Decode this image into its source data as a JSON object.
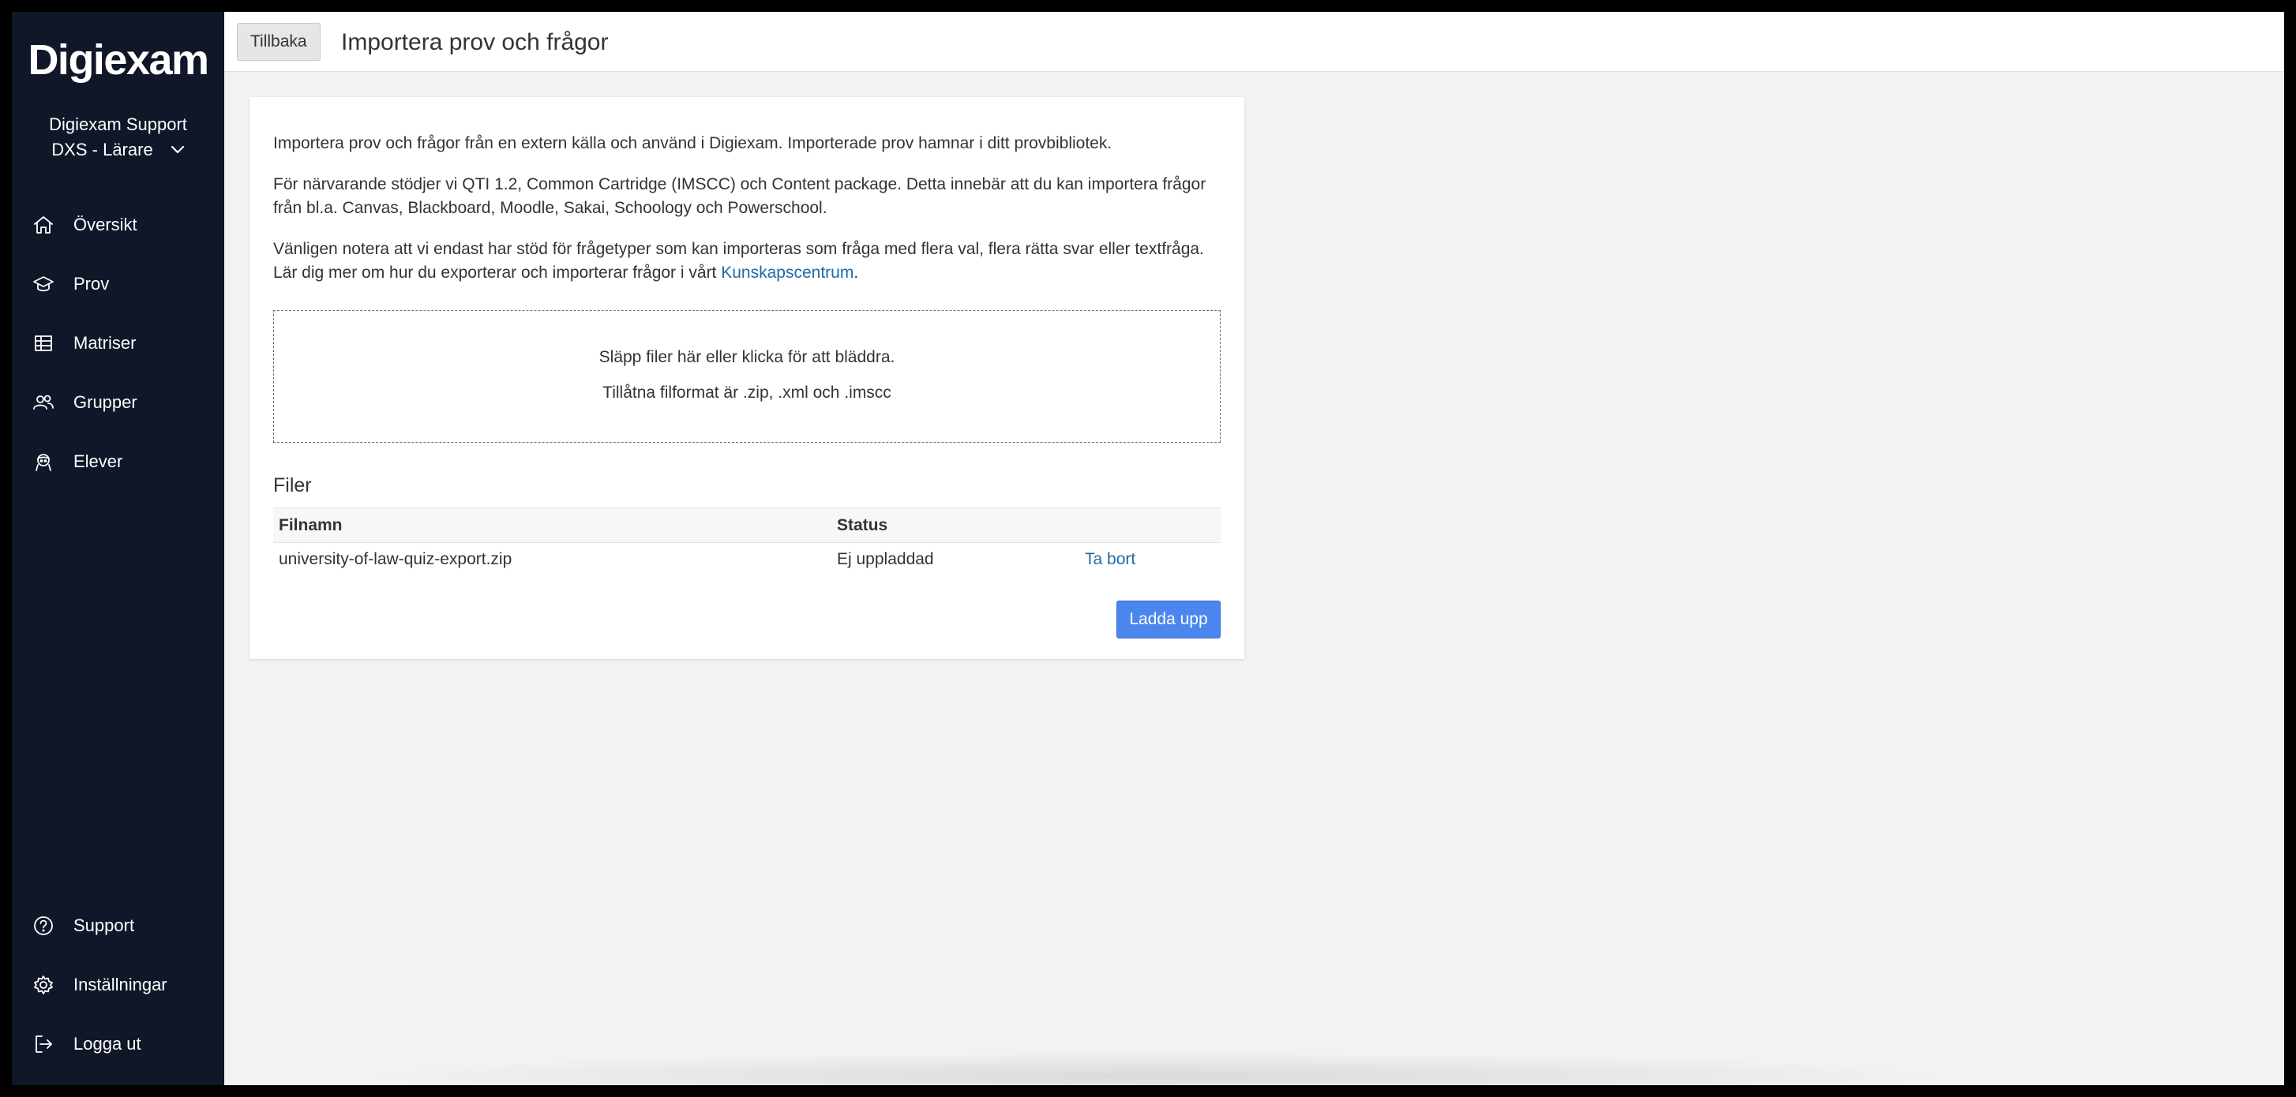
{
  "sidebar": {
    "logo": "Digiexam",
    "org_name": "Digiexam Support",
    "org_role": "DXS - Lärare",
    "nav_top": [
      {
        "label": "Översikt",
        "icon": "home-icon"
      },
      {
        "label": "Prov",
        "icon": "graduation-cap-icon"
      },
      {
        "label": "Matriser",
        "icon": "table-icon"
      },
      {
        "label": "Grupper",
        "icon": "users-icon"
      },
      {
        "label": "Elever",
        "icon": "student-icon"
      }
    ],
    "nav_bottom": [
      {
        "label": "Support",
        "icon": "help-circle-icon"
      },
      {
        "label": "Inställningar",
        "icon": "gear-icon"
      },
      {
        "label": "Logga ut",
        "icon": "logout-icon"
      }
    ]
  },
  "header": {
    "back_label": "Tillbaka",
    "title": "Importera prov och frågor"
  },
  "intro": {
    "p1": "Importera prov och frågor från en extern källa och använd i Digiexam. Importerade prov hamnar i ditt provbibliotek.",
    "p2_line1": "För närvarande stödjer vi QTI 1.2, Common Cartridge (IMSCC) och Content package. Detta innebär att du kan importera frågor",
    "p2_line2": "från bl.a. Canvas, Blackboard, Moodle, Sakai, Schoology och Powerschool.",
    "p3_line1": "Vänligen notera att vi endast har stöd för frågetyper som kan importeras som fråga med flera val, flera rätta svar eller textfråga.",
    "p3_line2_prefix": "Lär dig mer om hur du exporterar och importerar frågor i vårt ",
    "p3_link": "Kunskapscentrum",
    "p3_suffix": "."
  },
  "dropzone": {
    "line1": "Släpp filer här eller klicka för att bläddra.",
    "line2": "Tillåtna filformat är .zip, .xml och .imscc"
  },
  "files": {
    "heading": "Filer",
    "columns": [
      "Filnamn",
      "Status",
      ""
    ],
    "rows": [
      {
        "name": "university-of-law-quiz-export.zip",
        "status": "Ej uppladdad",
        "action": "Ta bort"
      }
    ],
    "upload_label": "Ladda upp"
  },
  "colors": {
    "sidebar_bg": "#0f1728",
    "accent": "#4a86ee",
    "link": "#1f6aa6"
  }
}
